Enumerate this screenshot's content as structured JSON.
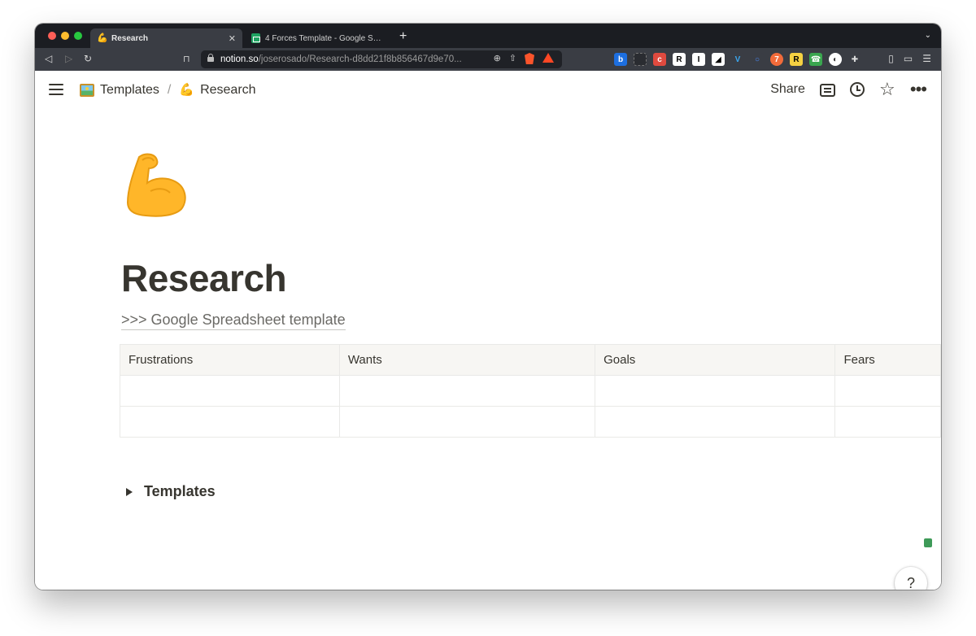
{
  "browser": {
    "tabs": [
      {
        "title": "Research",
        "favicon": "flexed-biceps-emoji",
        "active": true
      },
      {
        "title": "4 Forces Template - Google Sheets",
        "favicon": "google-sheets-icon",
        "active": false
      }
    ],
    "url": {
      "host": "notion.so",
      "path": "/joserosado/Research-d8dd21f8b856467d9e70..."
    }
  },
  "topbar": {
    "breadcrumbs": [
      {
        "label": "Templates",
        "icon": "framed-picture-emoji"
      },
      {
        "label": "Research",
        "icon": "flexed-biceps-emoji"
      }
    ],
    "breadcrumb_separator": "/",
    "share_label": "Share"
  },
  "page": {
    "emoji": "flexed-biceps-emoji",
    "title": "Research",
    "link_text": ">>> Google Spreadsheet template",
    "table": {
      "headers": [
        "Frustrations",
        "Wants",
        "Goals",
        "Fears"
      ],
      "rows": [
        [
          "",
          "",
          "",
          ""
        ],
        [
          "",
          "",
          "",
          ""
        ]
      ]
    },
    "toggle_label": "Templates",
    "help_label": "?"
  },
  "colors": {
    "text": "#37352f",
    "header_bg": "#f7f6f3",
    "border": "#e9e9e7",
    "tab_bar": "#1b1d22",
    "toolbar": "#3a3d44"
  }
}
